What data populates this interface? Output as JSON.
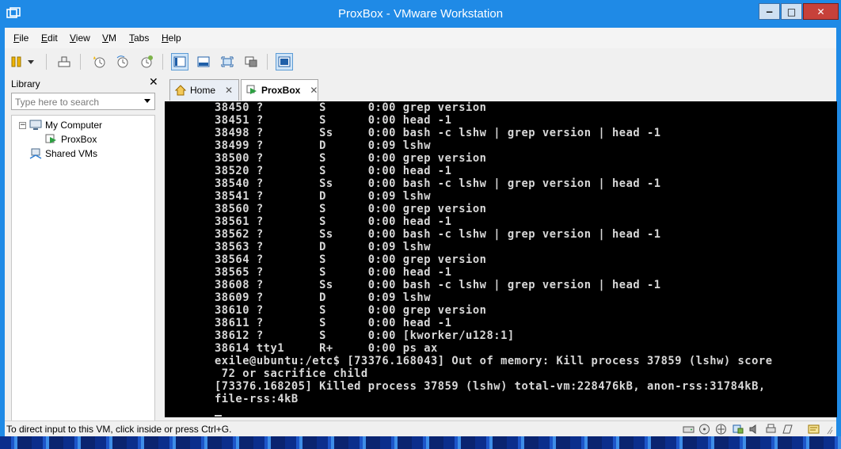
{
  "window": {
    "title": "ProxBox - VMware Workstation",
    "min_label": "−",
    "max_label": "□",
    "close_label": "✕"
  },
  "menu": [
    {
      "accel": "F",
      "rest": "ile"
    },
    {
      "accel": "E",
      "rest": "dit"
    },
    {
      "accel": "V",
      "rest": "iew"
    },
    {
      "accel": "V",
      "rest": "M"
    },
    {
      "accel": "T",
      "rest": "abs"
    },
    {
      "accel": "H",
      "rest": "elp"
    }
  ],
  "toolbar_icons": [
    "pause-icon",
    "send-keys-icon",
    "snapshot-icon",
    "revert-snapshot-icon",
    "snapshot-manager-icon",
    "console-view-icon",
    "thumbnail-view-icon",
    "fullscreen-icon",
    "unity-icon",
    "single-window-icon"
  ],
  "library": {
    "title": "Library",
    "close": "✕",
    "search_placeholder": "Type here to search",
    "tree": [
      {
        "label": "My Computer",
        "icon": "computer-icon"
      },
      {
        "label": "ProxBox",
        "icon": "vm-running-icon"
      },
      {
        "label": "Shared VMs",
        "icon": "shared-vms-icon"
      }
    ]
  },
  "tabs": [
    {
      "label": "Home",
      "close": "✕",
      "icon": "home-icon"
    },
    {
      "label": "ProxBox",
      "close": "✕",
      "icon": "vm-running-icon"
    }
  ],
  "console": {
    "lines": [
      "38450 ?        S      0:00 grep version",
      "38451 ?        S      0:00 head -1",
      "38498 ?        Ss     0:00 bash -c lshw | grep version | head -1",
      "38499 ?        D      0:09 lshw",
      "38500 ?        S      0:00 grep version",
      "38520 ?        S      0:00 head -1",
      "38540 ?        Ss     0:00 bash -c lshw | grep version | head -1",
      "38541 ?        D      0:09 lshw",
      "38560 ?        S      0:00 grep version",
      "38561 ?        S      0:00 head -1",
      "38562 ?        Ss     0:00 bash -c lshw | grep version | head -1",
      "38563 ?        D      0:09 lshw",
      "38564 ?        S      0:00 grep version",
      "38565 ?        S      0:00 head -1",
      "38608 ?        Ss     0:00 bash -c lshw | grep version | head -1",
      "38609 ?        D      0:09 lshw",
      "38610 ?        S      0:00 grep version",
      "38611 ?        S      0:00 head -1",
      "38612 ?        S      0:00 [kworker/u128:1]",
      "38614 tty1     R+     0:00 ps ax",
      "exile@ubuntu:/etc$ [73376.168043] Out of memory: Kill process 37859 (lshw) score",
      " 72 or sacrifice child",
      "[73376.168205] Killed process 37859 (lshw) total-vm:228476kB, anon-rss:31784kB,",
      "file-rss:4kB"
    ]
  },
  "status": {
    "text": "To direct input to this VM, click inside or press Ctrl+G.",
    "icons": [
      "hard-disk-icon",
      "cd-drive-icon",
      "network-icon",
      "usb-icon",
      "sound-icon",
      "printer-icon",
      "display-icon",
      "message-icon"
    ]
  }
}
